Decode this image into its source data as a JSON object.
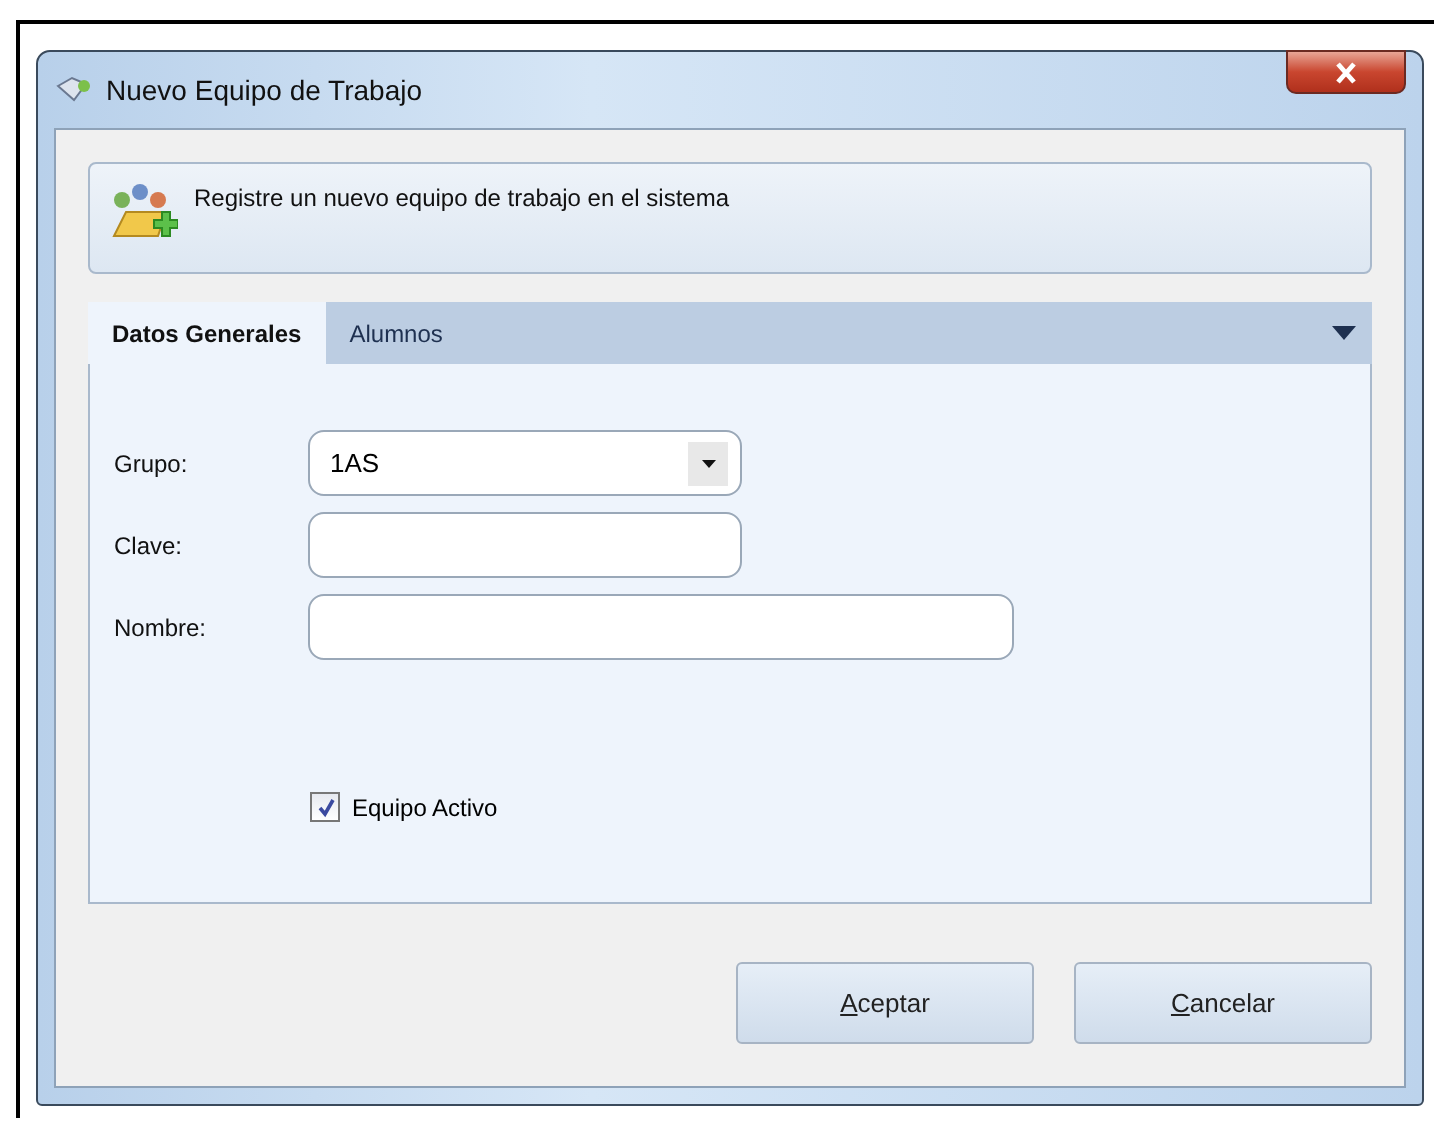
{
  "window": {
    "title": "Nuevo Equipo de Trabajo"
  },
  "header": {
    "message": "Registre un nuevo equipo de trabajo en el sistema"
  },
  "tabs": [
    {
      "label": "Datos Generales",
      "selected": true
    },
    {
      "label": "Alumnos",
      "selected": false
    }
  ],
  "form": {
    "fields": [
      {
        "kind": "dropdown",
        "label": "Grupo:",
        "value": "1AS",
        "wide": false
      },
      {
        "kind": "text",
        "label": "Clave:",
        "wide": false
      },
      {
        "kind": "text",
        "label": "Nombre:",
        "wide": true
      }
    ],
    "checkbox": {
      "label": "Equipo Activo",
      "checked": true
    }
  },
  "buttons": [
    {
      "label": "Aceptar",
      "underline_first": true
    },
    {
      "label": "Cancelar",
      "underline_first": true
    }
  ]
}
